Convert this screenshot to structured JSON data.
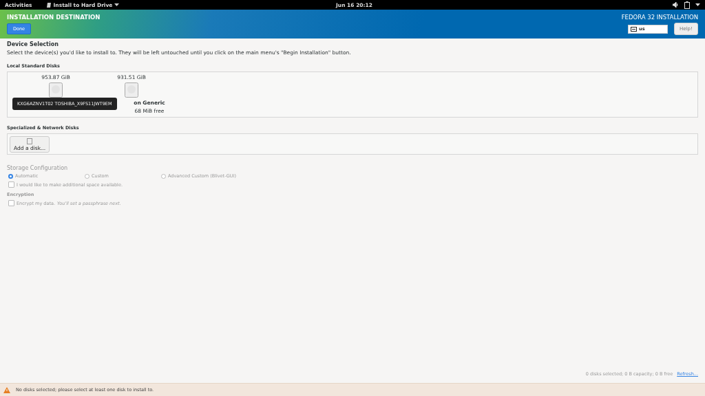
{
  "top_bar": {
    "activities": "Activities",
    "app_menu": "Install to Hard Drive",
    "clock": "Jun 16  20:12"
  },
  "header": {
    "title": "INSTALLATION DESTINATION",
    "done_button": "Done",
    "product": "FEDORA 32 INSTALLATION",
    "keyboard_layout": "us",
    "help_button": "Help!"
  },
  "device_selection": {
    "heading": "Device Selection",
    "description": "Select the device(s) you'd like to install to.  They will be left untouched until you click on the main menu's \"Begin Installation\" button."
  },
  "local_disks": {
    "heading": "Local Standard Disks",
    "disks": [
      {
        "size": "953.87 GiB",
        "selected": false
      },
      {
        "size": "931.51 GiB",
        "name": "on Generic",
        "details": "68 MiB free",
        "selected": false
      }
    ],
    "tooltip": "KXG6AZNV1T02 TOSHIBA_X9FS11JWT9EM"
  },
  "network_disks": {
    "heading": "Specialized & Network Disks",
    "add_button": "Add a disk..."
  },
  "storage_configuration": {
    "heading": "Storage Configuration",
    "disabled": true,
    "options": [
      {
        "label": "Automatic",
        "selected": true
      },
      {
        "label": "Custom",
        "selected": false
      },
      {
        "label": "Advanced Custom (Blivet-GUI)",
        "selected": false
      }
    ],
    "reclaim": {
      "label": "I would like to make additional space available.",
      "checked": false
    }
  },
  "encryption": {
    "heading": "Encryption",
    "label": "Encrypt my data.",
    "hint": "You'll set a passphrase next.",
    "checked": false
  },
  "summary": {
    "text": "0 disks selected; 0 B capacity; 0 B free",
    "refresh_link": "Refresh..."
  },
  "warning_bar": {
    "message": "No disks selected; please select at least one disk to install to."
  }
}
